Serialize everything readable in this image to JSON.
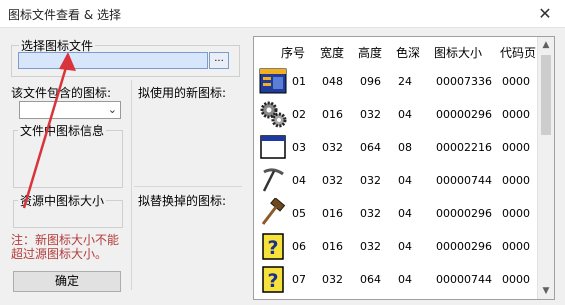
{
  "window": {
    "title": "图标文件查看 & 选择",
    "close_glyph": "✕"
  },
  "file_group": {
    "label": "选择图标文件",
    "path_value": "",
    "browse_label": "..."
  },
  "icons_in_file": {
    "label": "该文件包含的图标:",
    "selected": ""
  },
  "icon_info_label": "文件中图标信息",
  "resource_size_label": "资源中图标大小",
  "new_icon_label": "拟使用的新图标:",
  "replace_icon_label": "拟替换掉的图标:",
  "note": "注：新图标大小不能超过源图标大小。",
  "ok_button": "确定",
  "table": {
    "headers": [
      "序号",
      "宽度",
      "高度",
      "色深",
      "图标大小",
      "代码页"
    ],
    "rows": [
      {
        "icon": "window-blue-icon",
        "id": "01",
        "w": "048",
        "h": "096",
        "depth": "24",
        "size": "00007336",
        "cp": "0000"
      },
      {
        "icon": "gears-icon",
        "id": "02",
        "w": "016",
        "h": "032",
        "depth": "04",
        "size": "00000296",
        "cp": "0000"
      },
      {
        "icon": "window-frame-icon",
        "id": "03",
        "w": "032",
        "h": "064",
        "depth": "08",
        "size": "00002216",
        "cp": "0000"
      },
      {
        "icon": "pickaxe-icon",
        "id": "04",
        "w": "032",
        "h": "032",
        "depth": "04",
        "size": "00000744",
        "cp": "0000"
      },
      {
        "icon": "hammer-icon",
        "id": "05",
        "w": "016",
        "h": "032",
        "depth": "04",
        "size": "00000296",
        "cp": "0000"
      },
      {
        "icon": "question-mark-icon",
        "id": "06",
        "w": "016",
        "h": "032",
        "depth": "04",
        "size": "00000296",
        "cp": "0000"
      },
      {
        "icon": "question-mark-icon",
        "id": "07",
        "w": "032",
        "h": "064",
        "depth": "04",
        "size": "00000744",
        "cp": "0000"
      }
    ]
  },
  "annotation": {
    "color": "#d9343b"
  },
  "colors": {
    "input_bg": "#d7e6fa",
    "input_border": "#7a9ccf",
    "note": "#b43c3c"
  }
}
